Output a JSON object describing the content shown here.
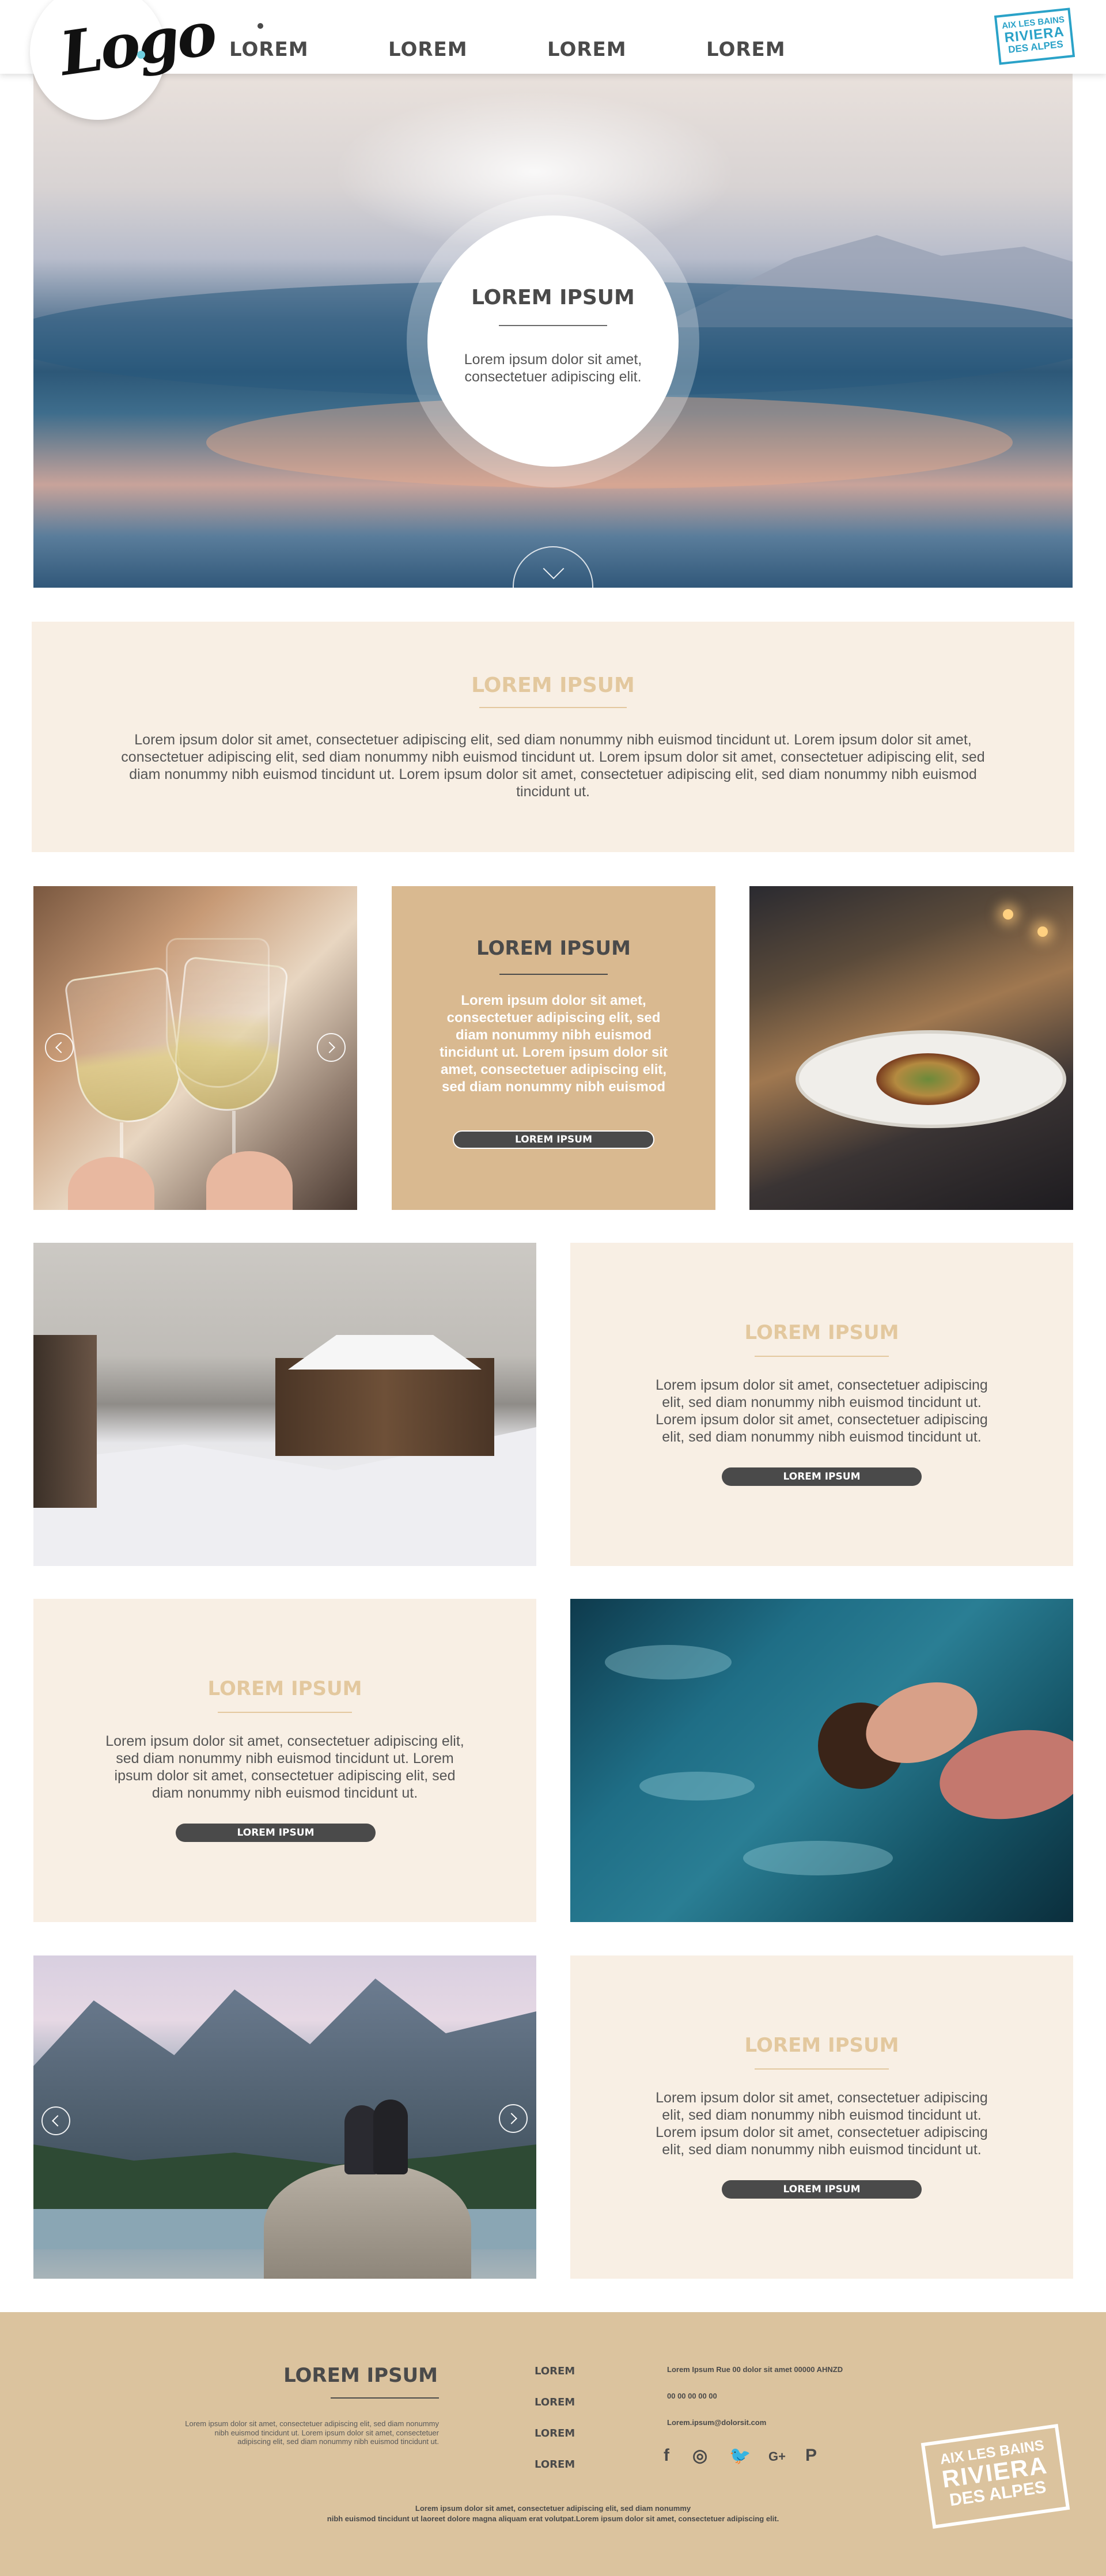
{
  "header": {
    "logo_text": "Logo",
    "nav": [
      "LOREM",
      "LOREM",
      "LOREM",
      "LOREM"
    ],
    "stamp": {
      "line1": "AIX LES BAINS",
      "line2": "RIVIERA",
      "line3": "DES ALPES"
    }
  },
  "hero": {
    "title": "LOREM IPSUM",
    "text": "Lorem ipsum dolor sit amet, consectetuer adipiscing elit."
  },
  "intro": {
    "title": "LOREM IPSUM",
    "text": "Lorem ipsum dolor sit amet, consectetuer adipiscing elit, sed diam nonummy nibh euismod tincidunt ut. Lorem ipsum dolor sit amet, consectetuer adipiscing elit, sed diam nonummy nibh euismod tincidunt ut. Lorem ipsum dolor sit amet, consectetuer adipiscing elit, sed diam nonummy nibh euismod tincidunt ut. Lorem ipsum dolor sit amet, consectetuer adipiscing elit, sed diam nonummy nibh euismod tincidunt ut."
  },
  "gold_card": {
    "title": "LOREM IPSUM",
    "text": "Lorem ipsum dolor sit amet, consectetuer adipiscing elit, sed diam nonummy nibh euismod tincidunt ut. Lorem ipsum dolor sit amet, consectetuer adipiscing elit, sed diam nonummy nibh euismod",
    "button": "LOREM IPSUM"
  },
  "cards": [
    {
      "title": "LOREM IPSUM",
      "text": "Lorem ipsum dolor sit amet, consectetuer adipiscing elit, sed diam nonummy nibh euismod tincidunt ut. Lorem ipsum dolor sit amet, consectetuer adipiscing elit, sed diam nonummy nibh euismod tincidunt ut.",
      "button": "LOREM IPSUM"
    },
    {
      "title": "LOREM IPSUM",
      "text": "Lorem ipsum dolor sit amet, consectetuer adipiscing elit, sed diam nonummy nibh euismod tincidunt ut. Lorem ipsum dolor sit amet, consectetuer adipiscing elit, sed diam nonummy nibh euismod tincidunt ut.",
      "button": "LOREM IPSUM"
    },
    {
      "title": "LOREM IPSUM",
      "text": "Lorem ipsum dolor sit amet, consectetuer adipiscing elit, sed diam nonummy nibh euismod tincidunt ut. Lorem ipsum dolor sit amet, consectetuer adipiscing elit, sed diam nonummy nibh euismod tincidunt ut.",
      "button": "LOREM IPSUM"
    }
  ],
  "footer": {
    "title": "LOREM IPSUM",
    "about": "Lorem ipsum dolor sit amet, consectetuer adipiscing elit, sed diam nonummy nibh euismod tincidunt ut. Lorem ipsum dolor sit amet, consectetuer adipiscing elit, sed diam nonummy nibh euismod tincidunt ut.",
    "links": [
      "LOREM",
      "LOREM",
      "LOREM",
      "LOREM"
    ],
    "address": "Lorem Ipsum Rue 00 dolor sit amet 00000 AHNZD",
    "phone": "00 00 00 00 00",
    "email": "Lorem.ipsum@dolorsit.com",
    "social": [
      "f",
      "◎",
      "🐦",
      "G+",
      "P"
    ],
    "bottom_line1": "Lorem ipsum dolor sit amet, consectetuer adipiscing elit, sed diam nonummy",
    "bottom_line2": "nibh euismod tincidunt ut laoreet dolore magna aliquam erat volutpat.Lorem ipsum dolor sit amet, consectetuer adipiscing elit.",
    "stamp": {
      "line1": "AIX LES BAINS",
      "line2": "RIVIERA",
      "line3": "DES ALPES"
    }
  },
  "colors": {
    "gold": "#d9b990",
    "gold_light": "#e3c89e",
    "cream": "#f8efe4",
    "dark": "#4a4a4a",
    "stamp_blue": "#2aa2c8"
  }
}
